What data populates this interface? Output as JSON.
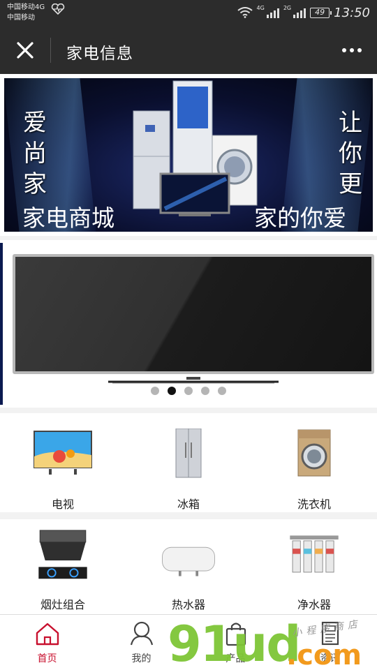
{
  "status": {
    "carrier_line1": "中国移动4G",
    "carrier_line2": "中国移动",
    "net1": "4G",
    "net2": "2G",
    "battery": "49",
    "time": "13:50"
  },
  "header": {
    "title": "家电信息"
  },
  "banner": {
    "left_vertical": [
      "爱",
      "尚",
      "家"
    ],
    "left_bottom": "家电商城",
    "right_vertical": [
      "让",
      "你",
      "更"
    ],
    "right_bottom": "家的你爱"
  },
  "carousel": {
    "dot_count": 5,
    "active_index": 1
  },
  "categories_row1": [
    {
      "label": "电视",
      "icon": "tv-icon"
    },
    {
      "label": "冰箱",
      "icon": "fridge-icon"
    },
    {
      "label": "洗衣机",
      "icon": "washing-machine-icon"
    }
  ],
  "categories_row2": [
    {
      "label": "烟灶组合",
      "icon": "range-hood-icon"
    },
    {
      "label": "热水器",
      "icon": "water-heater-icon"
    },
    {
      "label": "净水器",
      "icon": "water-purifier-icon"
    }
  ],
  "tabs": [
    {
      "label": "首页",
      "icon": "home-icon",
      "active": true
    },
    {
      "label": "我的",
      "icon": "user-icon",
      "active": false
    },
    {
      "label": "产品",
      "icon": "bag-icon",
      "active": false
    },
    {
      "label": "资讯",
      "icon": "news-icon",
      "active": false
    }
  ],
  "watermark": {
    "main": "91ud",
    "suffix": ".com",
    "tagline": "小程序商店"
  },
  "colors": {
    "bar_bg": "#2c2c2c",
    "accent": "#c8102e",
    "dot_active": "#111111",
    "dot_inactive": "#b5b5b5"
  }
}
